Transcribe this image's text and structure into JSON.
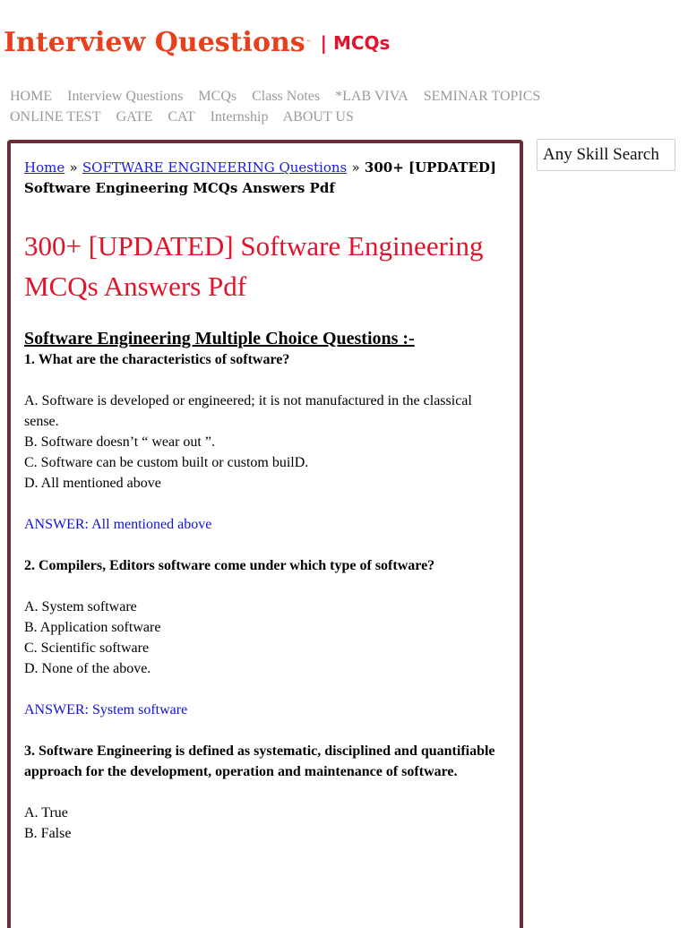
{
  "header": {
    "brand_main": "Interview Questions",
    "brand_tm": "™",
    "brand_sub": "| MCQs"
  },
  "nav": {
    "items": [
      "HOME",
      "Interview Questions",
      "MCQs",
      "Class Notes",
      "*LAB VIVA",
      "SEMINAR TOPICS",
      "ONLINE TEST",
      "GATE",
      "CAT",
      "Internship",
      "ABOUT US"
    ]
  },
  "breadcrumb": {
    "home": "Home",
    "sep": "»",
    "category": "SOFTWARE ENGINEERING Questions",
    "current": "300+ [UPDATED] Software Engineering MCQs Answers Pdf"
  },
  "article": {
    "title": "300+ [UPDATED] Software Engineering MCQs Answers Pdf",
    "subheading": "Software Engineering Multiple Choice Questions :-",
    "questions": [
      {
        "question": "1. What are the characteristics of software?",
        "options": [
          "A. Software is developed or engineered; it is not manufactured in the classical sense.",
          "B. Software doesn’t “ wear out ”.",
          "C. Software can be custom built or custom builD.",
          "D. All mentioned above"
        ],
        "answer": "ANSWER: All mentioned above"
      },
      {
        "question": "2. Compilers, Editors software come under which type of software?",
        "options": [
          "A. System software",
          "B. Application software",
          "C. Scientific software",
          "D. None of the above."
        ],
        "answer": "ANSWER: System software"
      },
      {
        "question": "3. Software Engineering is defined as systematic, disciplined and quantifiable approach for the development, operation and maintenance of software.",
        "options": [
          "A. True",
          "B. False"
        ]
      }
    ]
  },
  "search": {
    "placeholder": "Any Skill Search"
  },
  "colors": {
    "brand": "#e8401c",
    "title": "#e0142b",
    "link": "#1a1ae6",
    "answer": "#1010d8",
    "box_border": "#6e2a35",
    "nav": "#9a9a9a"
  }
}
